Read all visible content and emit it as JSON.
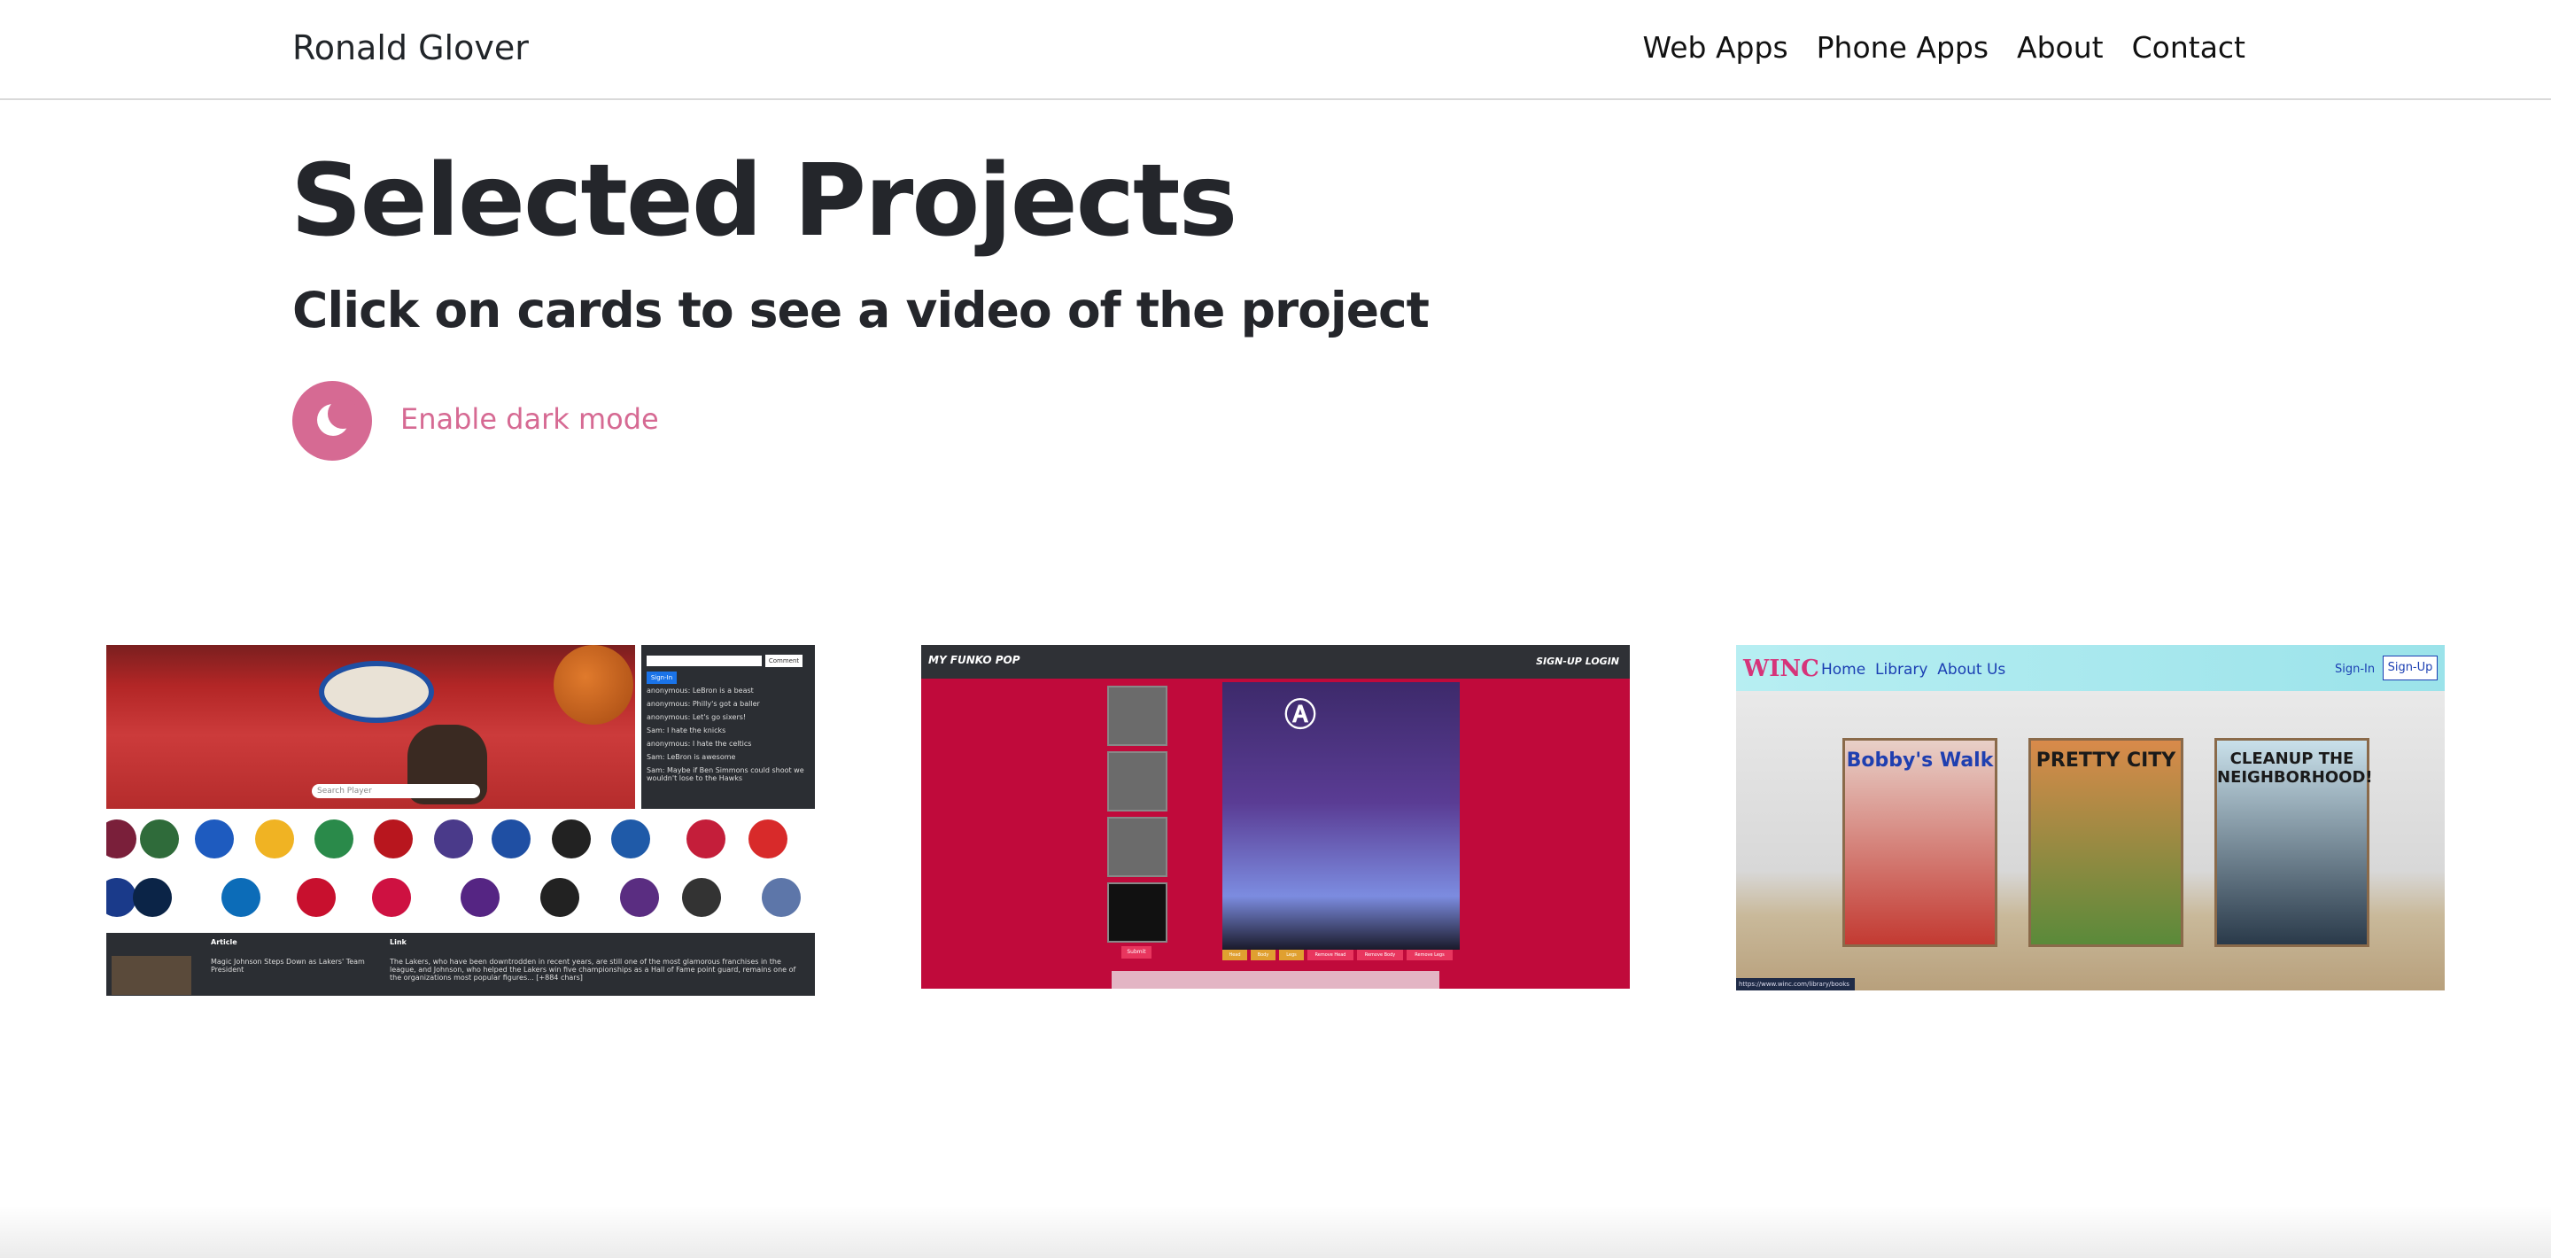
{
  "navbar": {
    "brand": "Ronald Glover",
    "links": [
      "Web Apps",
      "Phone Apps",
      "About",
      "Contact"
    ]
  },
  "hero": {
    "title": "Selected Projects",
    "subtitle": "Click on cards to see a video of the project",
    "dark_mode_label": "Enable dark mode"
  },
  "cards": [
    {
      "search_placeholder": "Search Player",
      "chat_button": "Comment",
      "sign_in": "Sign-In",
      "chat_lines": [
        "anonymous: LeBron is a beast",
        "anonymous: Philly's got a baller",
        "anonymous: Let's go sixers!",
        "Sam: I hate the knicks",
        "anonymous: I hate the celtics",
        "Sam: LeBron is awesome",
        "Sam: Maybe if Ben Simmons could shoot we wouldn't lose to the Hawks"
      ],
      "table_headers": [
        "Article",
        "Link"
      ],
      "article_title": "Magic Johnson Steps Down as Lakers' Team President",
      "article_text": "The Lakers, who have been downtrodden in recent years, are still one of the most glamorous franchises in the league, and Johnson, who helped the Lakers win five championships as a Hall of Fame point guard, remains one of the organizations most popular figures... [+884 chars]"
    },
    {
      "logo": "MY FUNKO POP",
      "nav": "SIGN-UP   LOGIN",
      "small_button": "Submit",
      "buttons": [
        "Head",
        "Body",
        "Legs",
        "Remove Head",
        "Remove Body",
        "Remove Legs"
      ]
    },
    {
      "logo": "WINC",
      "links": [
        "Home",
        "Library",
        "About Us"
      ],
      "sign_in": "Sign-In",
      "sign_up": "Sign-Up",
      "books": [
        "Bobby's Walk",
        "PRETTY CITY",
        "CLEANUP THE NEIGHBORHOOD!"
      ],
      "url": "https://www.winc.com/library/books"
    }
  ],
  "colors": {
    "accent": "#d66a93",
    "text": "#24262b",
    "funko_red": "#c00a3b"
  }
}
